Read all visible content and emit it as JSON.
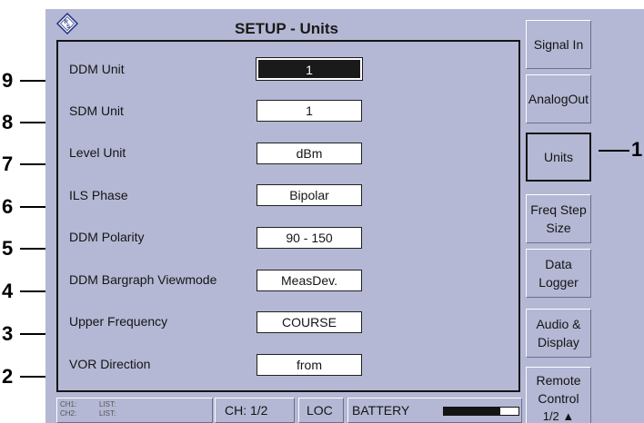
{
  "header": {
    "title": "SETUP - Units",
    "logo_icon": "rohde-schwarz-logo"
  },
  "rows": [
    {
      "label": "DDM Unit",
      "value": "1",
      "selected": true
    },
    {
      "label": "SDM Unit",
      "value": "1"
    },
    {
      "label": "Level Unit",
      "value": "dBm"
    },
    {
      "label": "ILS Phase",
      "value": "Bipolar"
    },
    {
      "label": "DDM Polarity",
      "value": "90 - 150"
    },
    {
      "label": "DDM Bargraph Viewmode",
      "value": "MeasDev."
    },
    {
      "label": "Upper Frequency",
      "value": "COURSE"
    },
    {
      "label": "VOR Direction",
      "value": "from"
    }
  ],
  "softkeys": [
    {
      "line1": "Signal In",
      "line2": ""
    },
    {
      "line1": "AnalogOut",
      "line2": ""
    },
    {
      "line1": "Units",
      "line2": "",
      "active": true
    },
    {
      "line1": "Freq Step",
      "line2": "Size"
    },
    {
      "line1": "Data",
      "line2": "Logger"
    },
    {
      "line1": "Audio &",
      "line2": "Display"
    },
    {
      "line1": "Remote",
      "line2": "Control",
      "page": "1/2 ▲"
    }
  ],
  "statusbar": {
    "ch1": "CH1:",
    "ch2": "CH2:",
    "list1": "LIST:",
    "list2": "LIST:",
    "channel": "CH: 1/2",
    "mode": "LOC",
    "battery_label": "BATTERY",
    "battery_level": 0.75
  },
  "callouts": {
    "left": [
      "9",
      "8",
      "7",
      "6",
      "5",
      "4",
      "3",
      "2"
    ],
    "right": "1"
  },
  "colors": {
    "screen_bg": "#b4b8d4",
    "selected_bg": "#1a1a1a"
  }
}
